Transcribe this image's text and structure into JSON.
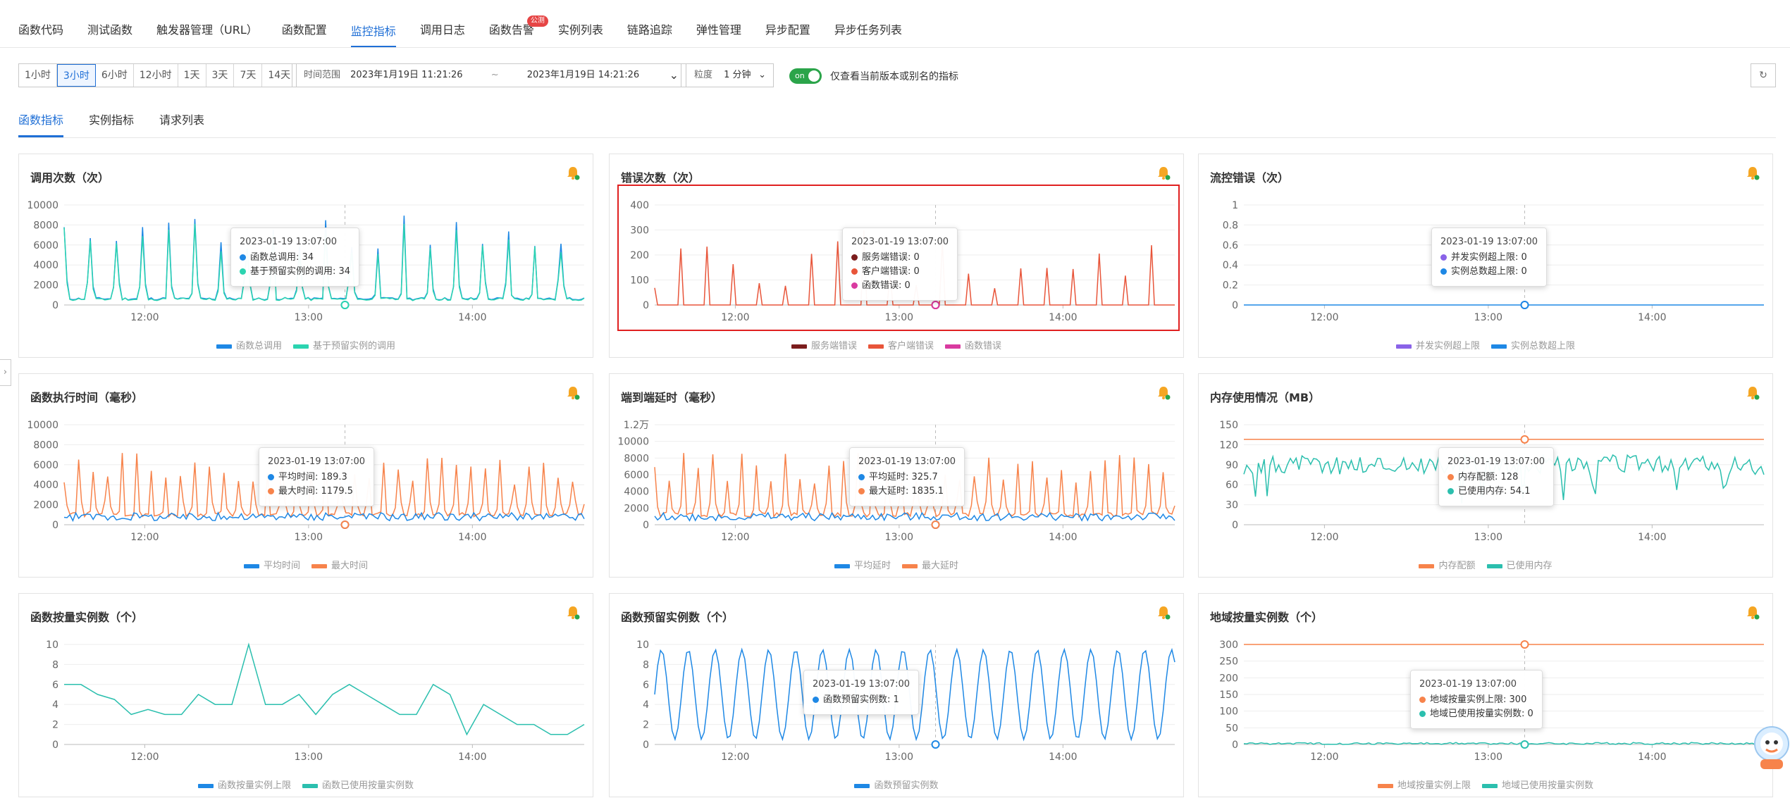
{
  "top_tabs": [
    {
      "label": "函数代码"
    },
    {
      "label": "测试函数"
    },
    {
      "label": "触发器管理（URL）"
    },
    {
      "label": "函数配置"
    },
    {
      "label": "监控指标",
      "active": true
    },
    {
      "label": "调用日志"
    },
    {
      "label": "函数告警",
      "badge": "公测"
    },
    {
      "label": "实例列表"
    },
    {
      "label": "链路追踪"
    },
    {
      "label": "弹性管理"
    },
    {
      "label": "异步配置"
    },
    {
      "label": "异步任务列表"
    }
  ],
  "filters": {
    "ranges": [
      "1小时",
      "3小时",
      "6小时",
      "12小时",
      "1天",
      "3天",
      "7天",
      "14天"
    ],
    "active_range": "3小时",
    "time_range_label": "时间范围",
    "time_start": "2023年1月19日 11:21:26",
    "time_sep": "~",
    "time_end": "2023年1月19日 14:21:26",
    "granularity_label": "粒度",
    "granularity_value": "1 分钟",
    "toggle_state": "on",
    "toggle_label": "仅查看当前版本或别名的指标"
  },
  "sub_tabs": [
    {
      "label": "函数指标",
      "active": true
    },
    {
      "label": "实例指标"
    },
    {
      "label": "请求列表"
    }
  ],
  "colors": {
    "accent": "#1f6fd6",
    "blue": "#1e88e5",
    "teal": "#2bbfae",
    "orange": "#f7834b",
    "darkred": "#7b1d1d",
    "red": "#e8553a",
    "magenta": "#d93ba0",
    "purple": "#8a63e8",
    "highlight_border": "#e02020"
  },
  "charts": [
    {
      "title": "调用次数（次）",
      "yticks": [
        "10000",
        "8000",
        "6000",
        "4000",
        "2000",
        "0"
      ],
      "xticks": [
        "12:00",
        "13:00",
        "14:00"
      ],
      "legend": [
        {
          "name": "函数总调用",
          "color": "#1e88e5"
        },
        {
          "name": "基于预留实例的调用",
          "color": "#2bd4b0"
        }
      ],
      "tooltip": {
        "date": "2023-01-19 13:07:00",
        "items": [
          {
            "label": "函数总调用",
            "value": "34",
            "color": "#1e88e5"
          },
          {
            "label": "基于预留实例的调用",
            "value": "34",
            "color": "#2bd4b0"
          }
        ]
      }
    },
    {
      "title": "错误次数（次）",
      "highlight": true,
      "yticks": [
        "400",
        "300",
        "200",
        "100",
        "0"
      ],
      "xticks": [
        "12:00",
        "13:00",
        "14:00"
      ],
      "legend": [
        {
          "name": "服务端错误",
          "color": "#7b1d1d"
        },
        {
          "name": "客户端错误",
          "color": "#e8553a"
        },
        {
          "name": "函数错误",
          "color": "#d93ba0"
        }
      ],
      "tooltip": {
        "date": "2023-01-19 13:07:00",
        "items": [
          {
            "label": "服务端错误",
            "value": "0",
            "color": "#7b1d1d"
          },
          {
            "label": "客户端错误",
            "value": "0",
            "color": "#e8553a"
          },
          {
            "label": "函数错误",
            "value": "0",
            "color": "#d93ba0"
          }
        ]
      }
    },
    {
      "title": "流控错误（次）",
      "yticks": [
        "1",
        "0.8",
        "0.6",
        "0.4",
        "0.2",
        "0"
      ],
      "xticks": [
        "12:00",
        "13:00",
        "14:00"
      ],
      "legend": [
        {
          "name": "并发实例超上限",
          "color": "#8a63e8"
        },
        {
          "name": "实例总数超上限",
          "color": "#1e88e5"
        }
      ],
      "tooltip": {
        "date": "2023-01-19 13:07:00",
        "items": [
          {
            "label": "并发实例超上限",
            "value": "0",
            "color": "#8a63e8"
          },
          {
            "label": "实例总数超上限",
            "value": "0",
            "color": "#1e88e5"
          }
        ]
      }
    },
    {
      "title": "函数执行时间（毫秒）",
      "yticks": [
        "10000",
        "8000",
        "6000",
        "4000",
        "2000",
        "0"
      ],
      "xticks": [
        "12:00",
        "13:00",
        "14:00"
      ],
      "legend": [
        {
          "name": "平均时间",
          "color": "#1e88e5"
        },
        {
          "name": "最大时间",
          "color": "#f7834b"
        }
      ],
      "tooltip": {
        "date": "2023-01-19 13:07:00",
        "items": [
          {
            "label": "平均时间",
            "value": "189.3",
            "color": "#1e88e5"
          },
          {
            "label": "最大时间",
            "value": "1179.5",
            "color": "#f7834b"
          }
        ]
      }
    },
    {
      "title": "端到端延时（毫秒）",
      "yticks": [
        "1.2万",
        "10000",
        "8000",
        "6000",
        "4000",
        "2000",
        "0"
      ],
      "xticks": [
        "12:00",
        "13:00",
        "14:00"
      ],
      "legend": [
        {
          "name": "平均延时",
          "color": "#1e88e5"
        },
        {
          "name": "最大延时",
          "color": "#f7834b"
        }
      ],
      "tooltip": {
        "date": "2023-01-19 13:07:00",
        "items": [
          {
            "label": "平均延时",
            "value": "325.7",
            "color": "#1e88e5"
          },
          {
            "label": "最大延时",
            "value": "1835.1",
            "color": "#f7834b"
          }
        ]
      }
    },
    {
      "title": "内存使用情况（MB）",
      "yticks": [
        "150",
        "120",
        "90",
        "60",
        "30",
        "0"
      ],
      "xticks": [
        "12:00",
        "13:00",
        "14:00"
      ],
      "legend": [
        {
          "name": "内存配额",
          "color": "#f7834b"
        },
        {
          "name": "已使用内存",
          "color": "#2bbfae"
        }
      ],
      "tooltip": {
        "date": "2023-01-19 13:07:00",
        "items": [
          {
            "label": "内存配额",
            "value": "128",
            "color": "#f7834b"
          },
          {
            "label": "已使用内存",
            "value": "54.1",
            "color": "#2bbfae"
          }
        ]
      }
    },
    {
      "title": "函数按量实例数（个）",
      "yticks": [
        "10",
        "8",
        "6",
        "4",
        "2",
        "0"
      ],
      "xticks": [
        "12:00",
        "13:00",
        "14:00"
      ],
      "legend": [
        {
          "name": "函数按量实例上限",
          "color": "#1e88e5"
        },
        {
          "name": "函数已使用按量实例数",
          "color": "#2bbfae"
        }
      ]
    },
    {
      "title": "函数预留实例数（个）",
      "yticks": [
        "10",
        "8",
        "6",
        "4",
        "2",
        "0"
      ],
      "xticks": [
        "12:00",
        "13:00",
        "14:00"
      ],
      "legend": [
        {
          "name": "函数预留实例数",
          "color": "#1e88e5"
        }
      ],
      "tooltip": {
        "date": "2023-01-19 13:07:00",
        "items": [
          {
            "label": "函数预留实例数",
            "value": "1",
            "color": "#1e88e5"
          }
        ]
      }
    },
    {
      "title": "地域按量实例数（个）",
      "yticks": [
        "300",
        "250",
        "200",
        "150",
        "100",
        "50",
        "0"
      ],
      "xticks": [
        "12:00",
        "13:00",
        "14:00"
      ],
      "legend": [
        {
          "name": "地域按量实例上限",
          "color": "#f7834b"
        },
        {
          "name": "地域已使用按量实例数",
          "color": "#2bbfae"
        }
      ],
      "tooltip": {
        "date": "2023-01-19 13:07:00",
        "items": [
          {
            "label": "地域按量实例上限",
            "value": "300",
            "color": "#f7834b"
          },
          {
            "label": "地域已使用按量实例数",
            "value": "0",
            "color": "#2bbfae"
          }
        ]
      }
    }
  ]
}
